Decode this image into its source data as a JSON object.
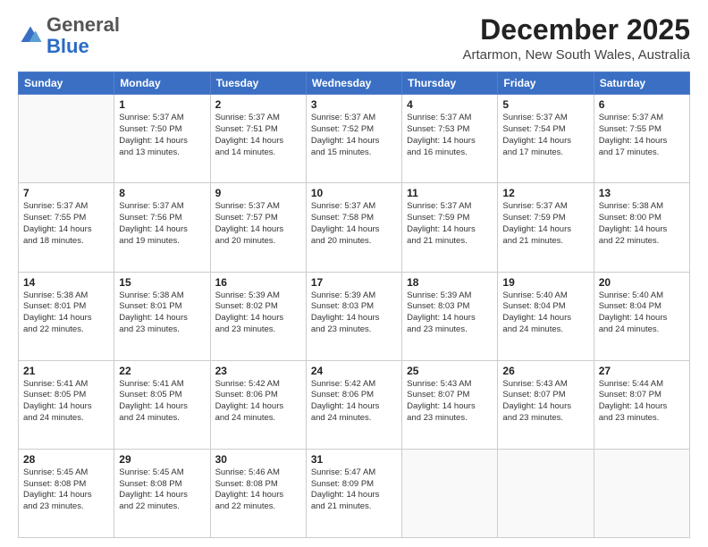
{
  "logo": {
    "general": "General",
    "blue": "Blue"
  },
  "header": {
    "month_year": "December 2025",
    "location": "Artarmon, New South Wales, Australia"
  },
  "days_of_week": [
    "Sunday",
    "Monday",
    "Tuesday",
    "Wednesday",
    "Thursday",
    "Friday",
    "Saturday"
  ],
  "weeks": [
    [
      {
        "day": "",
        "info": ""
      },
      {
        "day": "1",
        "info": "Sunrise: 5:37 AM\nSunset: 7:50 PM\nDaylight: 14 hours\nand 13 minutes."
      },
      {
        "day": "2",
        "info": "Sunrise: 5:37 AM\nSunset: 7:51 PM\nDaylight: 14 hours\nand 14 minutes."
      },
      {
        "day": "3",
        "info": "Sunrise: 5:37 AM\nSunset: 7:52 PM\nDaylight: 14 hours\nand 15 minutes."
      },
      {
        "day": "4",
        "info": "Sunrise: 5:37 AM\nSunset: 7:53 PM\nDaylight: 14 hours\nand 16 minutes."
      },
      {
        "day": "5",
        "info": "Sunrise: 5:37 AM\nSunset: 7:54 PM\nDaylight: 14 hours\nand 17 minutes."
      },
      {
        "day": "6",
        "info": "Sunrise: 5:37 AM\nSunset: 7:55 PM\nDaylight: 14 hours\nand 17 minutes."
      }
    ],
    [
      {
        "day": "7",
        "info": "Sunrise: 5:37 AM\nSunset: 7:55 PM\nDaylight: 14 hours\nand 18 minutes."
      },
      {
        "day": "8",
        "info": "Sunrise: 5:37 AM\nSunset: 7:56 PM\nDaylight: 14 hours\nand 19 minutes."
      },
      {
        "day": "9",
        "info": "Sunrise: 5:37 AM\nSunset: 7:57 PM\nDaylight: 14 hours\nand 20 minutes."
      },
      {
        "day": "10",
        "info": "Sunrise: 5:37 AM\nSunset: 7:58 PM\nDaylight: 14 hours\nand 20 minutes."
      },
      {
        "day": "11",
        "info": "Sunrise: 5:37 AM\nSunset: 7:59 PM\nDaylight: 14 hours\nand 21 minutes."
      },
      {
        "day": "12",
        "info": "Sunrise: 5:37 AM\nSunset: 7:59 PM\nDaylight: 14 hours\nand 21 minutes."
      },
      {
        "day": "13",
        "info": "Sunrise: 5:38 AM\nSunset: 8:00 PM\nDaylight: 14 hours\nand 22 minutes."
      }
    ],
    [
      {
        "day": "14",
        "info": "Sunrise: 5:38 AM\nSunset: 8:01 PM\nDaylight: 14 hours\nand 22 minutes."
      },
      {
        "day": "15",
        "info": "Sunrise: 5:38 AM\nSunset: 8:01 PM\nDaylight: 14 hours\nand 23 minutes."
      },
      {
        "day": "16",
        "info": "Sunrise: 5:39 AM\nSunset: 8:02 PM\nDaylight: 14 hours\nand 23 minutes."
      },
      {
        "day": "17",
        "info": "Sunrise: 5:39 AM\nSunset: 8:03 PM\nDaylight: 14 hours\nand 23 minutes."
      },
      {
        "day": "18",
        "info": "Sunrise: 5:39 AM\nSunset: 8:03 PM\nDaylight: 14 hours\nand 23 minutes."
      },
      {
        "day": "19",
        "info": "Sunrise: 5:40 AM\nSunset: 8:04 PM\nDaylight: 14 hours\nand 24 minutes."
      },
      {
        "day": "20",
        "info": "Sunrise: 5:40 AM\nSunset: 8:04 PM\nDaylight: 14 hours\nand 24 minutes."
      }
    ],
    [
      {
        "day": "21",
        "info": "Sunrise: 5:41 AM\nSunset: 8:05 PM\nDaylight: 14 hours\nand 24 minutes."
      },
      {
        "day": "22",
        "info": "Sunrise: 5:41 AM\nSunset: 8:05 PM\nDaylight: 14 hours\nand 24 minutes."
      },
      {
        "day": "23",
        "info": "Sunrise: 5:42 AM\nSunset: 8:06 PM\nDaylight: 14 hours\nand 24 minutes."
      },
      {
        "day": "24",
        "info": "Sunrise: 5:42 AM\nSunset: 8:06 PM\nDaylight: 14 hours\nand 24 minutes."
      },
      {
        "day": "25",
        "info": "Sunrise: 5:43 AM\nSunset: 8:07 PM\nDaylight: 14 hours\nand 23 minutes."
      },
      {
        "day": "26",
        "info": "Sunrise: 5:43 AM\nSunset: 8:07 PM\nDaylight: 14 hours\nand 23 minutes."
      },
      {
        "day": "27",
        "info": "Sunrise: 5:44 AM\nSunset: 8:07 PM\nDaylight: 14 hours\nand 23 minutes."
      }
    ],
    [
      {
        "day": "28",
        "info": "Sunrise: 5:45 AM\nSunset: 8:08 PM\nDaylight: 14 hours\nand 23 minutes."
      },
      {
        "day": "29",
        "info": "Sunrise: 5:45 AM\nSunset: 8:08 PM\nDaylight: 14 hours\nand 22 minutes."
      },
      {
        "day": "30",
        "info": "Sunrise: 5:46 AM\nSunset: 8:08 PM\nDaylight: 14 hours\nand 22 minutes."
      },
      {
        "day": "31",
        "info": "Sunrise: 5:47 AM\nSunset: 8:09 PM\nDaylight: 14 hours\nand 21 minutes."
      },
      {
        "day": "",
        "info": ""
      },
      {
        "day": "",
        "info": ""
      },
      {
        "day": "",
        "info": ""
      }
    ]
  ]
}
